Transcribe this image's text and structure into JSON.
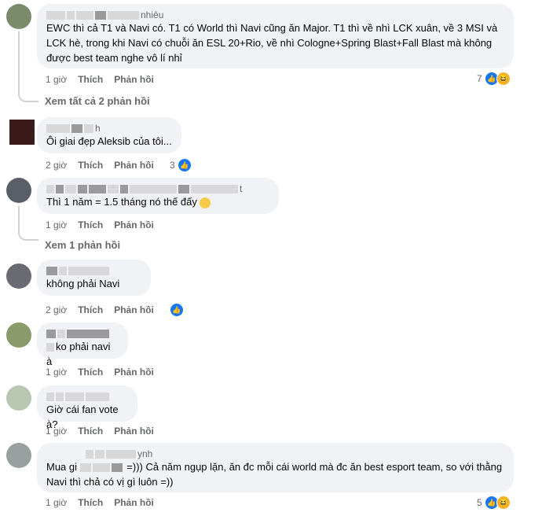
{
  "comments": [
    {
      "name_suffix": "nhiêu",
      "text": "EWC thì cả T1 và Navi có. T1 có World thì Navi cũng ăn Major. T1 thì về nhì LCK xuân, về 3 MSI và LCK hè, trong khi Navi có chuỗi ăn ESL 20+Rio, về nhì Cologne+Spring Blast+Fall Blast mà không được best team nghe vô lí nhỉ",
      "time": "1 giờ",
      "like": "Thích",
      "reply": "Phản hồi",
      "reactions": "7"
    },
    {
      "name_suffix": "h",
      "text": "Ôi giai đẹp Aleksib của tôi...",
      "time": "2 giờ",
      "like": "Thích",
      "reply": "Phản hồi",
      "reactions": "3"
    },
    {
      "name_suffix": "t",
      "text": "Thì 1 năm = 1.5 tháng nó thế đấy",
      "time": "1 giờ",
      "like": "Thích",
      "reply": "Phản hồi",
      "reactions": ""
    },
    {
      "name_suffix": "",
      "text": "không phải Navi",
      "time": "2 giờ",
      "like": "Thích",
      "reply": "Phản hồi",
      "reactions": ""
    },
    {
      "name_suffix": "",
      "text": "ko phải navi à",
      "time": "1 giờ",
      "like": "Thích",
      "reply": "Phản hồi",
      "reactions": ""
    },
    {
      "name_suffix": "",
      "text": "Giờ cái fan vote à?",
      "time": "1 giờ",
      "like": "Thích",
      "reply": "Phản hồi",
      "reactions": ""
    },
    {
      "name_suffix": "ynh",
      "text_prefix": "Mua gi",
      "text": "=))) Cả năm ngụp lặn, ăn đc mỗi cái world mà đc ăn best esport team, so với thằng Navi thì chả có vị gì luôn =))",
      "time": "1 giờ",
      "like": "Thích",
      "reply": "Phản hồi",
      "reactions": "5"
    }
  ],
  "view_replies_1": "Xem tất cả 2 phản hồi",
  "view_replies_2": "Xem 1 phản hồi",
  "colors": {
    "bubble": "#f0f2f5",
    "meta": "#65676b",
    "like_blue": "#1877f2",
    "haha_yellow": "#f7b125"
  }
}
